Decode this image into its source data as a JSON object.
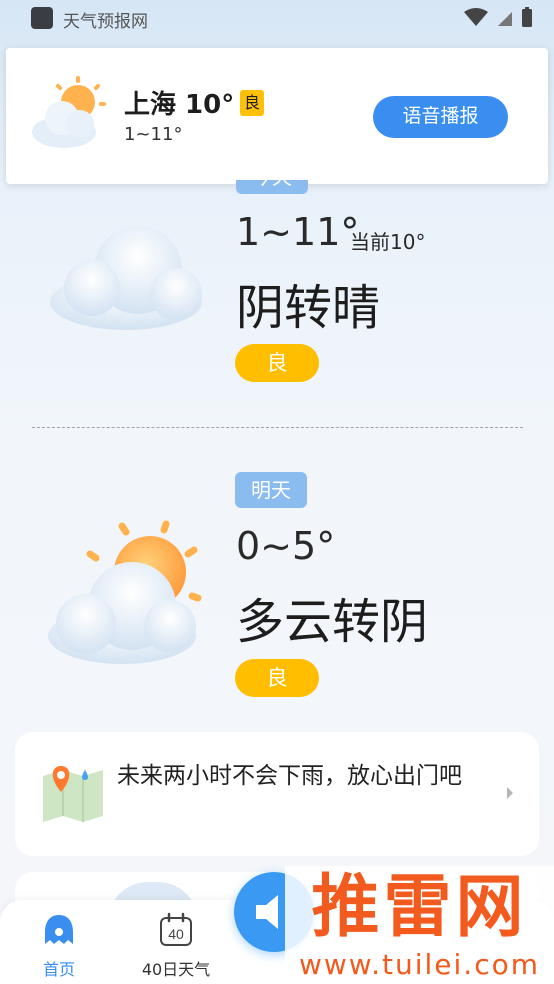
{
  "status_bar": {
    "app_title": "天气预报网"
  },
  "notification": {
    "city_temp": "上海 10°",
    "aqi_badge": "良",
    "temp_range": "1~11°",
    "voice_button": "语音播报"
  },
  "today": {
    "label": "今天",
    "temp_range": "1~11°",
    "current": "当前10°",
    "condition": "阴转晴",
    "aqi": "良"
  },
  "tomorrow": {
    "label": "明天",
    "temp_range": "0~5°",
    "condition": "多云转阴",
    "aqi": "良"
  },
  "rain_card": {
    "text": "未来两小时不会下雨，放心出门吧"
  },
  "bottom_nav": {
    "items": [
      {
        "label": "首页"
      },
      {
        "label": "40日天气",
        "icon_text": "40"
      }
    ]
  },
  "watermark": {
    "brand": "推雷网",
    "url": "www.tuilei.com"
  },
  "colors": {
    "accent_blue": "#3a8ef0",
    "aqi_yellow": "#ffbe00",
    "day_label_blue": "#8bbcf0",
    "watermark_orange": "#f25a1e"
  }
}
